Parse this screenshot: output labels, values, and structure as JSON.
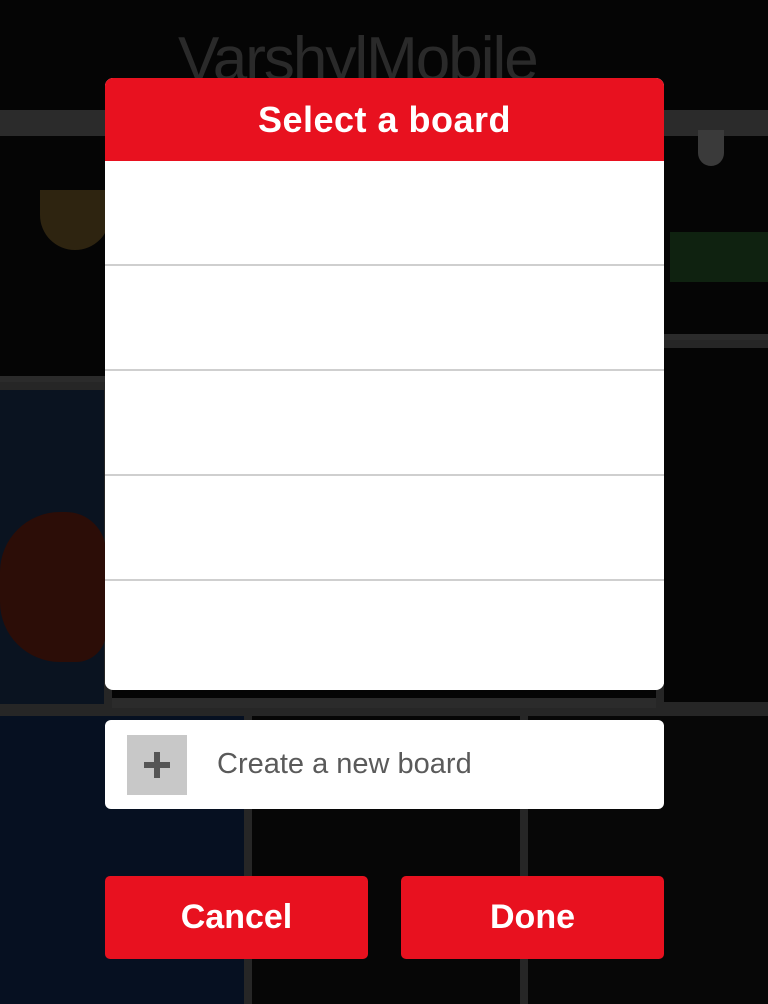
{
  "background": {
    "logo_part1": "Varshyl",
    "logo_part2": "Mobile"
  },
  "dialog": {
    "title": "Select a board",
    "boards": [
      "",
      "",
      "",
      "",
      ""
    ]
  },
  "create_board": {
    "icon": "plus-icon",
    "label": "Create a new board"
  },
  "actions": {
    "cancel_label": "Cancel",
    "done_label": "Done"
  },
  "colors": {
    "accent": "#e8111f",
    "plus_box": "#c8c8c8",
    "label_text": "#5a5a5a"
  }
}
